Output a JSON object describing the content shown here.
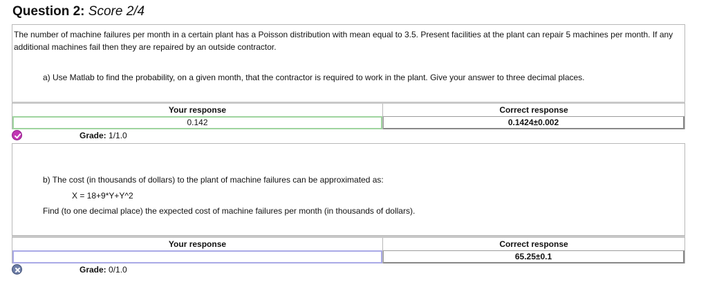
{
  "question": {
    "number_label": "Question 2:",
    "score_label": "Score 2/4",
    "intro": "The number of machine failures per month in a certain plant has a Poisson distribution with mean equal to 3.5. Present facilities at the plant can repair 5 machines per month. If any additional machines fail then they are repaired by an outside contractor."
  },
  "part_a": {
    "prompt": "a) Use Matlab to find the probability, on a given month, that the contractor is required to work in the plant.  Give your answer to three decimal places.",
    "your_response_header": "Your response",
    "correct_response_header": "Correct response",
    "your_response": "0.142",
    "correct_response": "0.1424±0.002",
    "grade_label": "Grade:",
    "grade_value": "1/1.0",
    "status_icon": "check-circle-icon",
    "status_color": "#c236b4"
  },
  "part_b": {
    "prompt": "b) The cost (in thousands of dollars) to the plant of machine failures can be approximated as:",
    "formula": "X = 18+9*Y+Y^2",
    "find": "Find (to one decimal place) the expected cost of machine failures per month (in thousands of dollars).",
    "your_response_header": "Your response",
    "correct_response_header": "Correct response",
    "your_response": "",
    "correct_response": "65.25±0.1",
    "grade_label": "Grade:",
    "grade_value": "0/1.0",
    "status_icon": "x-circle-icon",
    "status_color": "#6f7fa8"
  }
}
